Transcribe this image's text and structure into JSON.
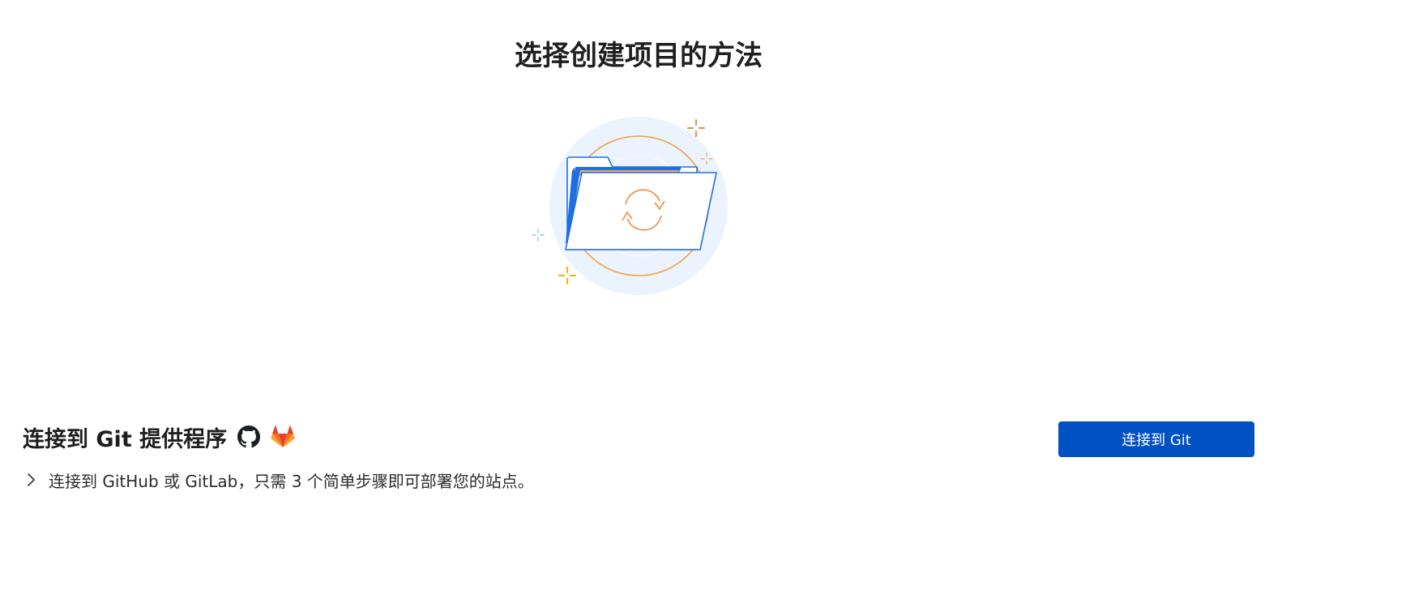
{
  "page": {
    "title": "选择创建项目的方法"
  },
  "illustration": {
    "icon": "folder-sync-illustration",
    "colors": {
      "circle_bg": "#eaf3fe",
      "ring": "#f5a142",
      "folder_stroke": "#1f6fe0",
      "folder_blue": "#1f6fe0",
      "sparkle_orange": "#f08a3c",
      "sparkle_yellow": "#f2b51d",
      "sparkle_blue": "#8ec5ee"
    }
  },
  "git": {
    "heading": "连接到 Git 提供程序",
    "providers": [
      {
        "name": "github",
        "icon": "github-icon"
      },
      {
        "name": "gitlab",
        "icon": "gitlab-icon"
      }
    ],
    "description": "连接到 GitHub 或 GitLab，只需 3 个简单步骤即可部署您的站点。",
    "expand_icon": "chevron-right-icon",
    "connect_button_label": "连接到 Git",
    "button_color": "#0051c3"
  }
}
